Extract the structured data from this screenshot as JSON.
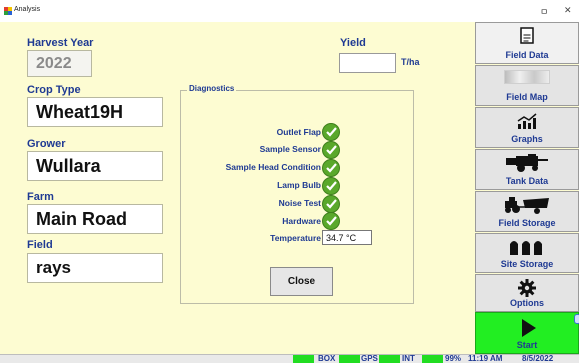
{
  "window": {
    "title": "Analysis",
    "minimize_glyph": "ㅁ",
    "close_glyph": "✕"
  },
  "colors": {
    "background": "#fdfcd2",
    "label_blue": "#1f3a93",
    "check_green": "#5aa82b",
    "start_green": "#22ee22"
  },
  "form": {
    "harvest_year_label": "Harvest Year",
    "harvest_year_value": "2022",
    "crop_type_label": "Crop Type",
    "crop_type_value": "Wheat19H",
    "grower_label": "Grower",
    "grower_value": "Wullara",
    "farm_label": "Farm",
    "farm_value": "Main Road",
    "field_label": "Field",
    "field_value": "rays",
    "yield_label": "Yield",
    "yield_value": "",
    "yield_unit": "T/ha"
  },
  "diagnostics": {
    "title": "Diagnostics",
    "items": [
      {
        "label": "Outlet Flap",
        "status": "ok"
      },
      {
        "label": "Sample Sensor",
        "status": "ok"
      },
      {
        "label": "Sample Head Condition",
        "status": "ok"
      },
      {
        "label": "Lamp Bulb",
        "status": "ok"
      },
      {
        "label": "Noise Test",
        "status": "ok"
      },
      {
        "label": "Hardware",
        "status": "ok"
      }
    ],
    "temperature_label": "Temperature",
    "temperature_value": "34.7 °C",
    "close_label": "Close"
  },
  "sidebar": {
    "items": [
      {
        "label": "Field Data",
        "icon": "document-icon"
      },
      {
        "label": "Field Map",
        "icon": "map-icon"
      },
      {
        "label": "Graphs",
        "icon": "chart-icon"
      },
      {
        "label": "Tank Data",
        "icon": "harvester-icon"
      },
      {
        "label": "Field Storage",
        "icon": "tractor-trailer-icon"
      },
      {
        "label": "Site Storage",
        "icon": "silos-icon"
      },
      {
        "label": "Options",
        "icon": "gear-icon"
      }
    ],
    "start_label": "Start"
  },
  "status_bar": {
    "box": "BOX",
    "gps": "GPS",
    "int": "INT",
    "battery": "99%",
    "time": "11:19 AM",
    "date": "8/5/2022"
  }
}
